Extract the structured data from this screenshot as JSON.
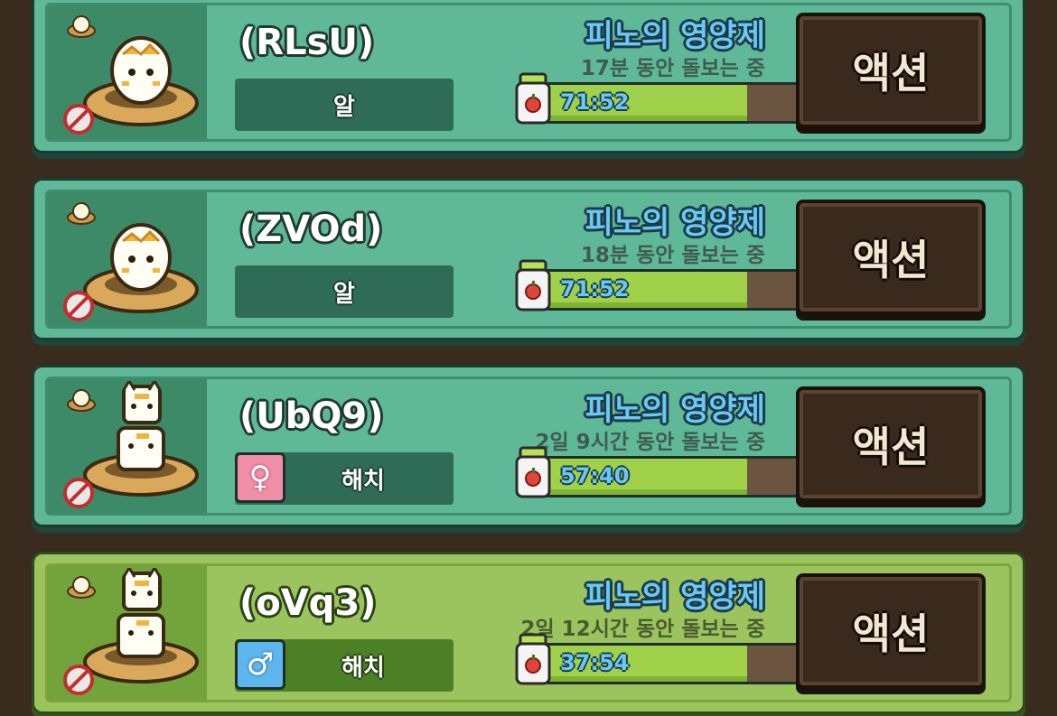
{
  "colors": {
    "card_teal": "#5fb897",
    "card_green": "#9bc45e",
    "background": "#3a2b1f",
    "item_name": "#6bc8f0",
    "timer_fill": "#9fd14a",
    "action_button": "#3a2a1d"
  },
  "rows": [
    {
      "name": "(RLsU)",
      "stage": "알",
      "gender": null,
      "item": "피노의 영양제",
      "care": "17분 동안 돌보는 중",
      "timer": "71:52",
      "fill": 0.8,
      "action": "액션",
      "art": "egg"
    },
    {
      "name": "(ZVOd)",
      "stage": "알",
      "gender": null,
      "item": "피노의 영양제",
      "care": "18분 동안 돌보는 중",
      "timer": "71:52",
      "fill": 0.8,
      "action": "액션",
      "art": "egg"
    },
    {
      "name": "(UbQ9)",
      "stage": "해치",
      "gender": "♀",
      "item": "피노의 영양제",
      "care": "2일 9시간 동안 돌보는 중",
      "timer": "57:40",
      "fill": 0.8,
      "action": "액션",
      "art": "cat"
    },
    {
      "name": "(oVq3)",
      "stage": "해치",
      "gender": "♂",
      "item": "피노의 영양제",
      "care": "2일 12시간 동안 돌보는 중",
      "timer": "37:54",
      "fill": 0.8,
      "action": "액션",
      "art": "cat"
    }
  ]
}
